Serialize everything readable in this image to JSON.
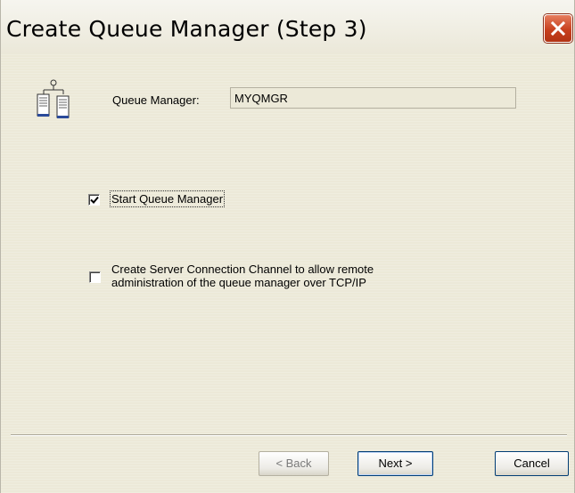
{
  "window": {
    "title": "Create Queue Manager (Step 3)",
    "close_icon": "close-icon"
  },
  "queue_manager": {
    "icon": "queue-manager-network-icon",
    "label": "Queue Manager:",
    "value": "MYQMGR"
  },
  "options": {
    "start_queue_manager": {
      "label": "Start Queue Manager",
      "checked": true
    },
    "server_connection_channel": {
      "label_line1": "Create Server Connection Channel to allow remote",
      "label_line2": "administration of the queue manager over TCP/IP",
      "checked": false
    }
  },
  "buttons": {
    "back": "< Back",
    "next": "Next >",
    "cancel": "Cancel"
  },
  "colors": {
    "dialog_background": "#ece9d8",
    "close_button": "#c8401e"
  }
}
